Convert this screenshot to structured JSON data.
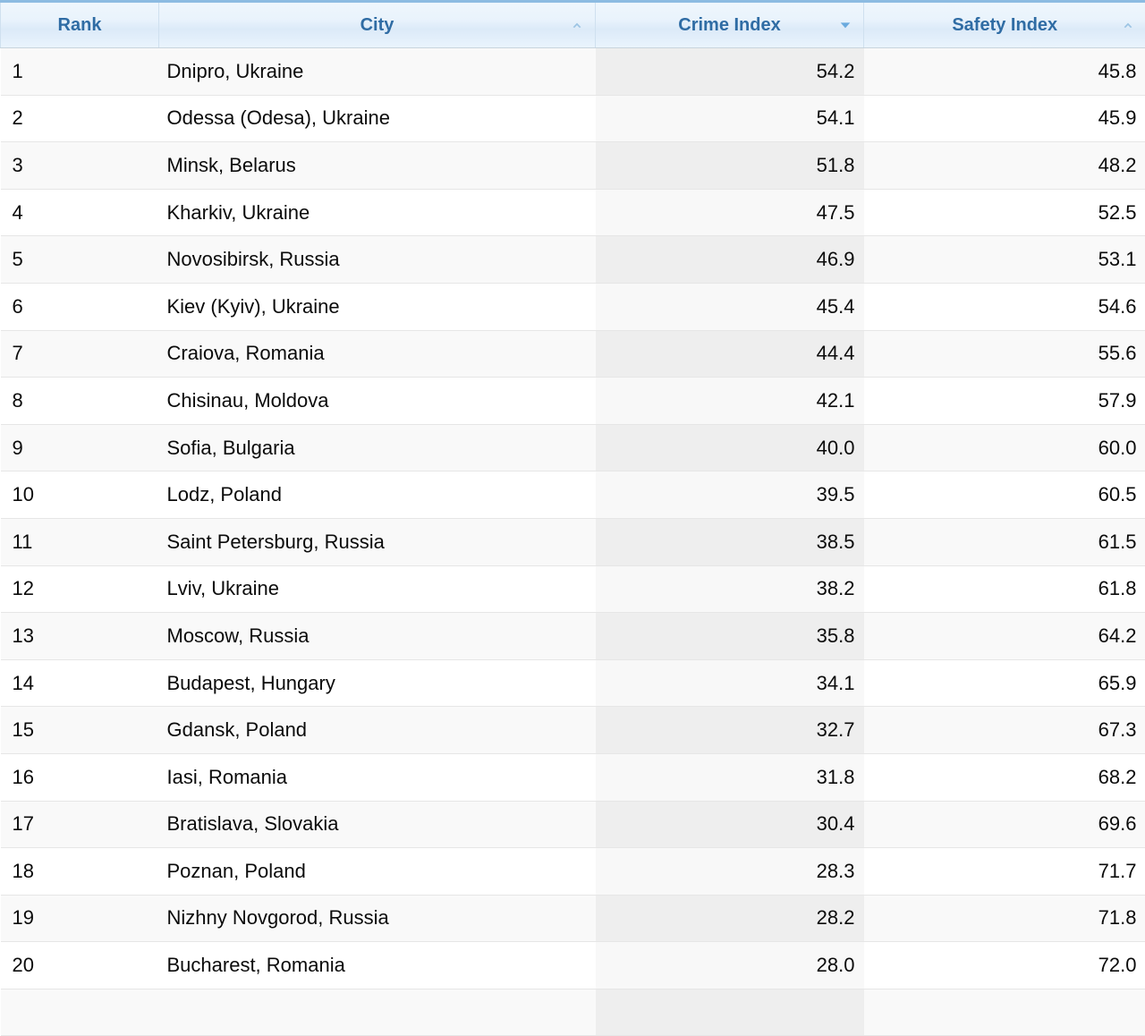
{
  "table": {
    "columns": [
      {
        "key": "rank",
        "label": "Rank",
        "align": "left",
        "sort": "none",
        "sort_icon": "chevron-up-icon"
      },
      {
        "key": "city",
        "label": "City",
        "align": "left",
        "sort": "ascending",
        "sort_icon": "chevron-up-icon"
      },
      {
        "key": "crime",
        "label": "Crime Index",
        "align": "right",
        "sort": "descending",
        "sort_icon": "triangle-down-icon",
        "active": true
      },
      {
        "key": "safety",
        "label": "Safety Index",
        "align": "right",
        "sort": "ascending",
        "sort_icon": "chevron-up-icon"
      }
    ],
    "rows": [
      {
        "rank": "1",
        "city": "Dnipro, Ukraine",
        "crime": "54.2",
        "safety": "45.8"
      },
      {
        "rank": "2",
        "city": "Odessa (Odesa), Ukraine",
        "crime": "54.1",
        "safety": "45.9"
      },
      {
        "rank": "3",
        "city": "Minsk, Belarus",
        "crime": "51.8",
        "safety": "48.2"
      },
      {
        "rank": "4",
        "city": "Kharkiv, Ukraine",
        "crime": "47.5",
        "safety": "52.5"
      },
      {
        "rank": "5",
        "city": "Novosibirsk, Russia",
        "crime": "46.9",
        "safety": "53.1"
      },
      {
        "rank": "6",
        "city": "Kiev (Kyiv), Ukraine",
        "crime": "45.4",
        "safety": "54.6"
      },
      {
        "rank": "7",
        "city": "Craiova, Romania",
        "crime": "44.4",
        "safety": "55.6"
      },
      {
        "rank": "8",
        "city": "Chisinau, Moldova",
        "crime": "42.1",
        "safety": "57.9"
      },
      {
        "rank": "9",
        "city": "Sofia, Bulgaria",
        "crime": "40.0",
        "safety": "60.0"
      },
      {
        "rank": "10",
        "city": "Lodz, Poland",
        "crime": "39.5",
        "safety": "60.5"
      },
      {
        "rank": "11",
        "city": "Saint Petersburg, Russia",
        "crime": "38.5",
        "safety": "61.5"
      },
      {
        "rank": "12",
        "city": "Lviv, Ukraine",
        "crime": "38.2",
        "safety": "61.8"
      },
      {
        "rank": "13",
        "city": "Moscow, Russia",
        "crime": "35.8",
        "safety": "64.2"
      },
      {
        "rank": "14",
        "city": "Budapest, Hungary",
        "crime": "34.1",
        "safety": "65.9"
      },
      {
        "rank": "15",
        "city": "Gdansk, Poland",
        "crime": "32.7",
        "safety": "67.3"
      },
      {
        "rank": "16",
        "city": "Iasi, Romania",
        "crime": "31.8",
        "safety": "68.2"
      },
      {
        "rank": "17",
        "city": "Bratislava, Slovakia",
        "crime": "30.4",
        "safety": "69.6"
      },
      {
        "rank": "18",
        "city": "Poznan, Poland",
        "crime": "28.3",
        "safety": "71.7"
      },
      {
        "rank": "19",
        "city": "Nizhny Novgorod, Russia",
        "crime": "28.2",
        "safety": "71.8"
      },
      {
        "rank": "20",
        "city": "Bucharest, Romania",
        "crime": "28.0",
        "safety": "72.0"
      }
    ]
  },
  "colors": {
    "header_text": "#2f6ca4",
    "header_top_border": "#8cbbe2",
    "header_bg_top": "#eef6fd",
    "header_bg_mid": "#dceaf8",
    "row_stripe": "#f9f9f9",
    "sorted_column_stripe": "#eeeeee",
    "row_border": "#e6e6e6",
    "sort_arrow_active": "#6aaade",
    "sort_arrow_inactive": "#9cc4e4"
  }
}
